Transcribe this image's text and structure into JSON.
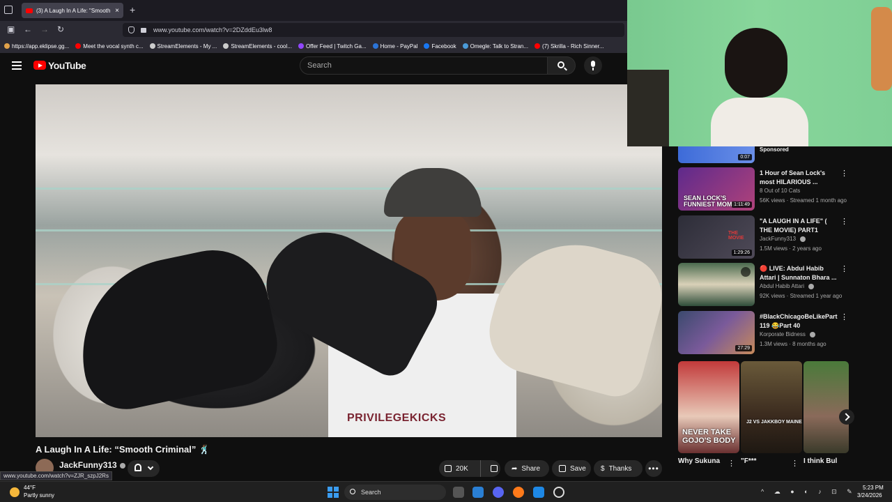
{
  "browser": {
    "tab_title": "(3) A Laugh In A Life: \"Smooth C",
    "tab_close": "×",
    "new_tab": "+",
    "url": "www.youtube.com/watch?v=2DZddEu3lw8",
    "nav": {
      "back": "←",
      "forward": "→",
      "reload": "↻"
    },
    "bookmarks": [
      {
        "label": "https://app.eklipse.gg...",
        "color": "#e0a24a"
      },
      {
        "label": "Meet the vocal synth c...",
        "color": "#ff0000"
      },
      {
        "label": "StreamElements - My ...",
        "color": "#cccccc"
      },
      {
        "label": "StreamElements - cool...",
        "color": "#cccccc"
      },
      {
        "label": "Offer Feed | Twitch Ga...",
        "color": "#9146ff"
      },
      {
        "label": "Home - PayPal",
        "color": "#2b74d8"
      },
      {
        "label": "Facebook",
        "color": "#1877f2"
      },
      {
        "label": "Omegle: Talk to Stran...",
        "color": "#4a9ad8"
      },
      {
        "label": "(7) Skrilla - Rich Sinner...",
        "color": "#ff0000"
      }
    ],
    "status_url": "www.youtube.com/watch?v=ZJR_szpJ2Rs"
  },
  "youtube": {
    "logo_text": "YouTube",
    "search_placeholder": "Search",
    "video": {
      "shirt_print": "PRIVILEGEKICKS",
      "title": "A Laugh In A Life: “Smooth Criminal” 🕺🏾",
      "channel": "JackFunny313",
      "likes": "20K",
      "share": "Share",
      "save": "Save",
      "thanks": "Thanks",
      "more": "•••"
    },
    "sidebar": {
      "sponsored_label": "Sponsored",
      "sponsored_duration": "0:07",
      "recs": [
        {
          "title": "1 Hour of Sean Lock's most HILARIOUS ...",
          "channel": "8 Out of 10 Cats",
          "meta": "56K views · Streamed 1 month ago",
          "duration": "1:11:49",
          "thumb_caption": "SEAN LOCK'S FUNNIEST MOMENTS"
        },
        {
          "title": "\"A LAUGH IN A LIFE\" ( THE MOVIE) PART1",
          "channel": "JackFunny313",
          "meta": "1.5M views · 2 years ago",
          "duration": "1:29:26",
          "thumb_caption": "THE MOVIE"
        },
        {
          "title": "🔴 LIVE: Abdul Habib Attari | Sunnaton Bhara ...",
          "channel": "Abdul Habib Attari",
          "meta": "92K views · Streamed 1 year ago",
          "duration": "",
          "thumb_caption": ""
        },
        {
          "title": "#BlackChicagoBeLikePart 119 😂Part 40",
          "channel": "Korporate Bidness",
          "meta": "1.3M views · 8 months ago",
          "duration": "27:29",
          "thumb_caption": ""
        }
      ],
      "shorts": [
        {
          "title": "Why Sukuna",
          "caption": "NEVER TAKE GOJO'S BODY"
        },
        {
          "title": "\"F***",
          "caption": "J2 VS JAKKBOY MAINE"
        },
        {
          "title": "I think Bul",
          "caption": ""
        }
      ]
    }
  },
  "taskbar": {
    "temperature": "44°F",
    "weather": "Partly sunny",
    "search": "Search",
    "time": "5:23 PM",
    "date": "3/24/2026",
    "tray_icons": "^ ☁ ● ◐ ♪ ⊡ ✎"
  },
  "colors": {
    "yt_red": "#ff0000",
    "bg": "#0f0f0f",
    "green_screen": "#7fcf95"
  }
}
